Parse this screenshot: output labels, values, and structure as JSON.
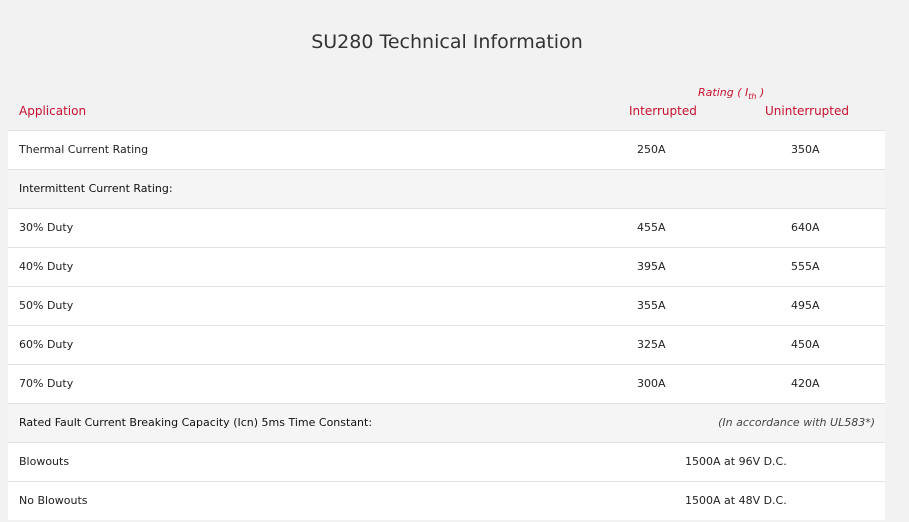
{
  "title": "SU280 Technical Information",
  "header": {
    "rating_caption_prefix": "Rating ( I",
    "rating_caption_sub": "th",
    "rating_caption_suffix": " )",
    "application": "Application",
    "interrupted": "Interrupted",
    "uninterrupted": "Uninterrupted"
  },
  "rows": [
    {
      "application": "Thermal Current Rating",
      "interrupted": "250A",
      "uninterrupted": "350A"
    },
    {
      "section": "Intermittent Current Rating:"
    },
    {
      "application": "30% Duty",
      "interrupted": "455A",
      "uninterrupted": "640A"
    },
    {
      "application": "40% Duty",
      "interrupted": "395A",
      "uninterrupted": "555A"
    },
    {
      "application": "50% Duty",
      "interrupted": "355A",
      "uninterrupted": "495A"
    },
    {
      "application": "60% Duty",
      "interrupted": "325A",
      "uninterrupted": "450A"
    },
    {
      "application": "70% Duty",
      "interrupted": "300A",
      "uninterrupted": "420A"
    },
    {
      "section": "Rated Fault Current Breaking Capacity (Icn) 5ms Time Constant:",
      "note": "(In accordance with UL583*)"
    },
    {
      "application": "Blowouts",
      "combined": "1500A at 96V D.C."
    },
    {
      "application": "No Blowouts",
      "combined": "1500A at 48V D.C."
    }
  ],
  "colors": {
    "accent": "#c8102e",
    "row_bg": "#ffffff",
    "section_bg": "#f5f5f5"
  }
}
